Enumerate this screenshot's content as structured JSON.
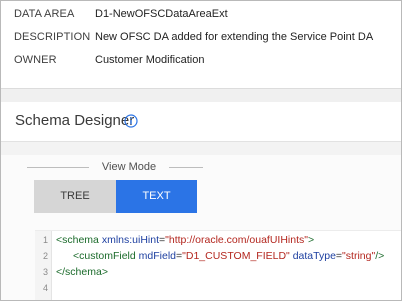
{
  "details": [
    {
      "label": "DATA AREA",
      "value": "D1-NewOFSCDataAreaExt"
    },
    {
      "label": "DESCRIPTION",
      "value": "New OFSC DA added for extending the Service Point DA"
    },
    {
      "label": "OWNER",
      "value": "Customer Modification"
    }
  ],
  "schema_designer": {
    "title": "Schema Designer",
    "view_mode": {
      "label": "View Mode",
      "tree_label": "TREE",
      "text_label": "TEXT",
      "selected": "TEXT"
    }
  },
  "editor": {
    "line_numbers": [
      "1",
      "2",
      "3",
      "4"
    ],
    "line1": {
      "open": "<schema",
      "attr": "xmlns:uiHint",
      "eq": "=",
      "val": "\"http://oracle.com/ouafUIHints\"",
      "close": ">"
    },
    "line2": {
      "open": "<customField",
      "attr1": "mdField",
      "eq1": "=",
      "val1": "\"D1_CUSTOM_FIELD\"",
      "attr2": "dataType",
      "eq2": "=",
      "val2": "\"string\"",
      "close": "/>"
    },
    "line3": {
      "text": "</schema>"
    }
  },
  "colors": {
    "accent_blue": "#2b74e6",
    "tag_green": "#1b6b2b",
    "attr_blue": "#1d3fa0",
    "string_red": "#b3261e"
  }
}
